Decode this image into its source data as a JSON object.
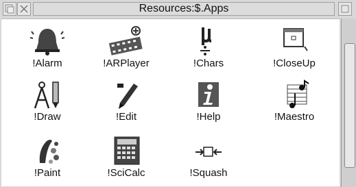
{
  "window": {
    "title": "Resources:$.Apps"
  },
  "apps": [
    {
      "label": "!Alarm",
      "icon": "alarm-bell-icon"
    },
    {
      "label": "!ARPlayer",
      "icon": "film-strip-icon"
    },
    {
      "label": "!Chars",
      "icon": "mu-divide-icon"
    },
    {
      "label": "!CloseUp",
      "icon": "magnifier-window-icon"
    },
    {
      "label": "!Draw",
      "icon": "compass-pencil-icon"
    },
    {
      "label": "!Edit",
      "icon": "pen-icon"
    },
    {
      "label": "!Help",
      "icon": "info-i-icon"
    },
    {
      "label": "!Maestro",
      "icon": "music-notes-icon"
    },
    {
      "label": "!Paint",
      "icon": "paint-brush-icon"
    },
    {
      "label": "!SciCalc",
      "icon": "calculator-icon"
    },
    {
      "label": "!Squash",
      "icon": "squash-arrows-icon"
    }
  ]
}
